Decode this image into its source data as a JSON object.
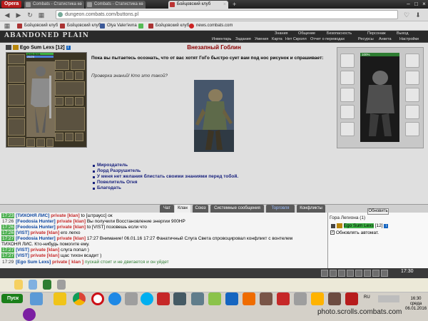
{
  "browser": {
    "menu_label": "Opera",
    "tabs": [
      {
        "title": "Combats - Статистика ко"
      },
      {
        "title": "Combats - Статистика ко"
      },
      {
        "title": "Бойцовский клуб"
      }
    ],
    "new_tab": "+",
    "url": "dungeon.combats.com/buttons.pl",
    "bookmarks": [
      {
        "label": "Бойцовский клуб"
      },
      {
        "label": "Бойцовский клуб"
      },
      {
        "label": "Olya Valer'evna"
      },
      {
        "label": "Бойцовский клуб"
      },
      {
        "label": "news.combats.com"
      }
    ]
  },
  "game": {
    "logo": "ABANDONED PLAIN",
    "top_nav": [
      "Знания",
      "Общение",
      "Безопасность",
      "Персонаж",
      "Выход"
    ],
    "bottom_nav": [
      "Инвентарь",
      "Задания",
      "Умения",
      "Карта",
      "Нет Скролл",
      "Отчет о переводах",
      "Ресурсы",
      "Анкета",
      "Настройки"
    ]
  },
  "character": {
    "name": "Ego Sum Lexs",
    "level": "[12]",
    "hp": "5051/5051",
    "mana": "25/25"
  },
  "event": {
    "title": "Внезапный Гоблин",
    "text": "Пока вы пытаетесь осознать, что от вас хотят ГоГо быстро сует вам под нос рисунок и спрашивает:",
    "question": "Проверка знаний! Кто это такой?",
    "answers": [
      "Мироздатель",
      "Лорд Разрушитель",
      "У меня нет желания блистать своими знаниями перед тобой.",
      "Повелитель Огня",
      "Благодать"
    ]
  },
  "enemy": {
    "hp": "100%"
  },
  "chat": {
    "tabs": [
      "Чат",
      "Клан",
      "Союз",
      "Системные сообщения",
      "Торговля",
      "Конфликты"
    ],
    "active_tab": "Клан",
    "messages": [
      {
        "time": "17:23",
        "user": "[ТИХОНЯ ЛИС]",
        "private": "private [klan]",
        "text": "to [штраусс] ок"
      },
      {
        "time": "17:26",
        "user": "[Feodosia Hunter]",
        "private": "private [klan]",
        "text": "Вы получили Восстановление энергии 900HP"
      },
      {
        "time": "17:26",
        "user": "[Feodosia Hunter]",
        "private": "private [klan]",
        "text": "to [VIST] позовешь если что"
      },
      {
        "time": "17:26",
        "user": "[VIST]",
        "private": "private [klan]",
        "text": "его легко"
      },
      {
        "time": "17:27",
        "user": "[Feodosia Hunter]",
        "private": "private [klan]",
        "text": "17:27 Внимание! 06.01.16 17:27 Фанатичный Слуга Света спровоцировал конфликт с вонтелем"
      },
      {
        "time": "",
        "user": "",
        "private": "",
        "text": "ТИХОНЯ ЛИС. Кто-нибудь помогите ему."
      },
      {
        "time": "17:27",
        "user": "[VIST]",
        "private": "private [klan]",
        "text": "слуга попал )"
      },
      {
        "time": "17:27",
        "user": "[VIST]",
        "private": "private [klan]",
        "text": "щас тихон всадит )"
      },
      {
        "time": "17:29",
        "user": "[Ego Sum Lexs]",
        "private": "private [ klan ]",
        "text": "пускай стоит и не двигается и он уйдет"
      }
    ]
  },
  "online": {
    "refresh_label": "Обновить",
    "room": "Гора Легиона (1)",
    "user": "Ego Sum Lexs",
    "user_level": "[12]",
    "auto_refresh": "Обновлять автомат."
  },
  "status_time": "17:30",
  "taskbar": {
    "start_label": "Пуск",
    "lang": "RU",
    "clock": "16:30",
    "day": "среда",
    "date": "06.01.2016"
  },
  "watermark": "photo.scrolls.combats.com"
}
